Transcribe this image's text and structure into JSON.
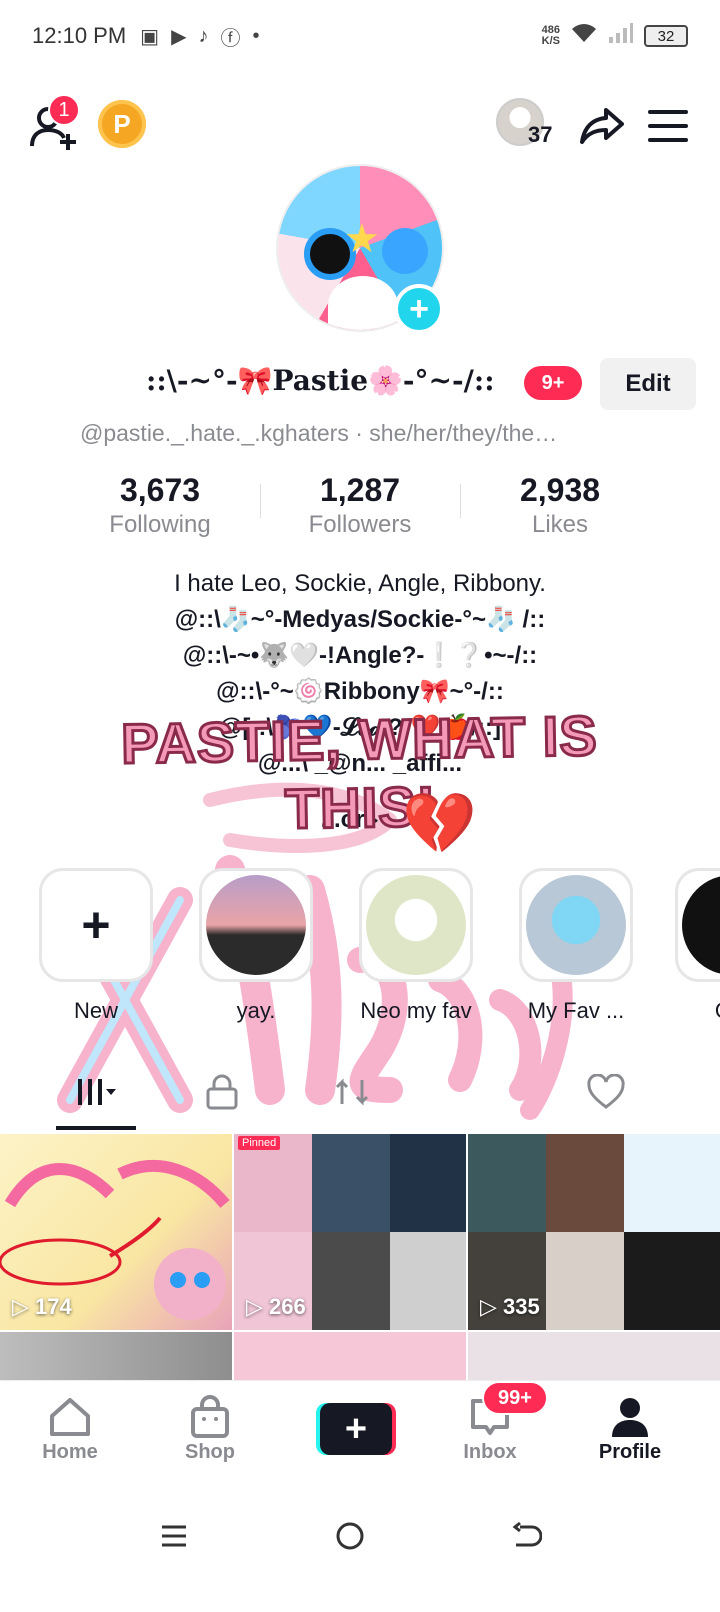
{
  "status_bar": {
    "time": "12:10 PM",
    "net_speed_value": "486",
    "net_speed_unit": "K/S",
    "battery": "32"
  },
  "top_bar": {
    "notification_count": "1",
    "coin_label": "P",
    "viewer_count": "37"
  },
  "profile": {
    "display_name": "::\\-~°-🎀Pastie🌸-°~-/::",
    "name_badge": "9+",
    "edit_label": "Edit",
    "username_line": "@pastie._.hate._.kghaters · she/her/they/the…"
  },
  "stats": [
    {
      "value": "3,673",
      "label": "Following"
    },
    {
      "value": "1,287",
      "label": "Followers"
    },
    {
      "value": "2,938",
      "label": "Likes"
    }
  ],
  "bio": {
    "line1": "I hate Leo, Sockie, Angle, Ribbony.",
    "line2": "@::\\🧦~°-Medyas/Sockie-°~🧦 /::",
    "line3": "@::\\-~•🐺🤍-!Angle?-❕❔•~-/::",
    "line4": "@::\\-°~🍥Ribbony🎀~°-/::",
    "line5": "@[::\\🫐💙-𝓛𝓮𝓸!?-❤️🍎/::]",
    "line6": "@...\\ _@n... _affi...",
    "line7": "...ord..."
  },
  "overlay": {
    "text_line1": "PASTIE, WHAT IS",
    "text_line2": "THIS!"
  },
  "stories": [
    {
      "label": "New"
    },
    {
      "label": "yay."
    },
    {
      "label": "Neo my fav"
    },
    {
      "label": "My Fav ..."
    },
    {
      "label": "Old"
    }
  ],
  "videos": [
    {
      "views": "174"
    },
    {
      "views": "266",
      "pinned": "Pinned"
    },
    {
      "views": "335"
    }
  ],
  "bottom_nav": {
    "home": "Home",
    "shop": "Shop",
    "inbox": "Inbox",
    "inbox_badge": "99+",
    "profile": "Profile"
  },
  "colors": {
    "accent": "#fe2c55",
    "cyan": "#25f4ee",
    "text": "#161823",
    "muted": "#8a8b91"
  }
}
